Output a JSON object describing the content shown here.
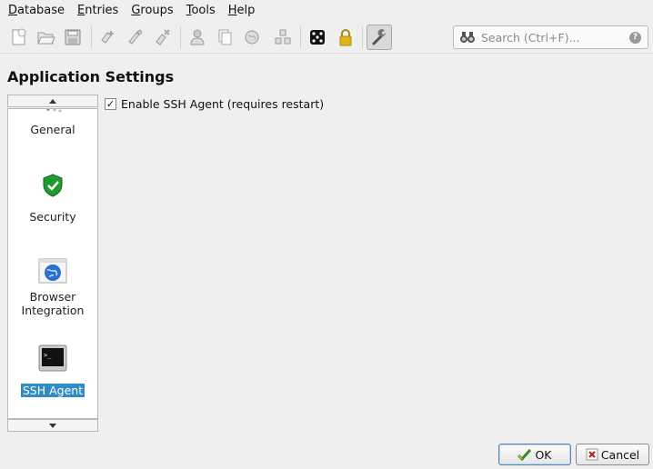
{
  "menu": [
    {
      "label": "Database",
      "accel": "D",
      "rest": "atabase"
    },
    {
      "label": "Entries",
      "accel": "E",
      "rest": "ntries"
    },
    {
      "label": "Groups",
      "accel": "G",
      "rest": "roups"
    },
    {
      "label": "Tools",
      "accel": "T",
      "rest": "ools"
    },
    {
      "label": "Help",
      "accel": "H",
      "rest": "elp"
    }
  ],
  "search": {
    "placeholder": "Search (Ctrl+F)..."
  },
  "page": {
    "title": "Application Settings"
  },
  "sidebar": {
    "items": [
      {
        "label": "General",
        "icon": "general-settings-icon"
      },
      {
        "label": "Security",
        "icon": "shield-check-icon"
      },
      {
        "label": "Browser Integration",
        "line1": "Browser",
        "line2": "Integration",
        "icon": "globe-browser-icon"
      },
      {
        "label": "SSH Agent",
        "icon": "terminal-icon",
        "selected": true
      }
    ]
  },
  "ssh": {
    "enable_label": "Enable SSH Agent (requires restart)",
    "enabled": true
  },
  "buttons": {
    "ok": "OK",
    "cancel": "Cancel"
  },
  "colors": {
    "selection": "#308cc6",
    "shield": "#1e9a2e",
    "lock": "#e0b418"
  }
}
